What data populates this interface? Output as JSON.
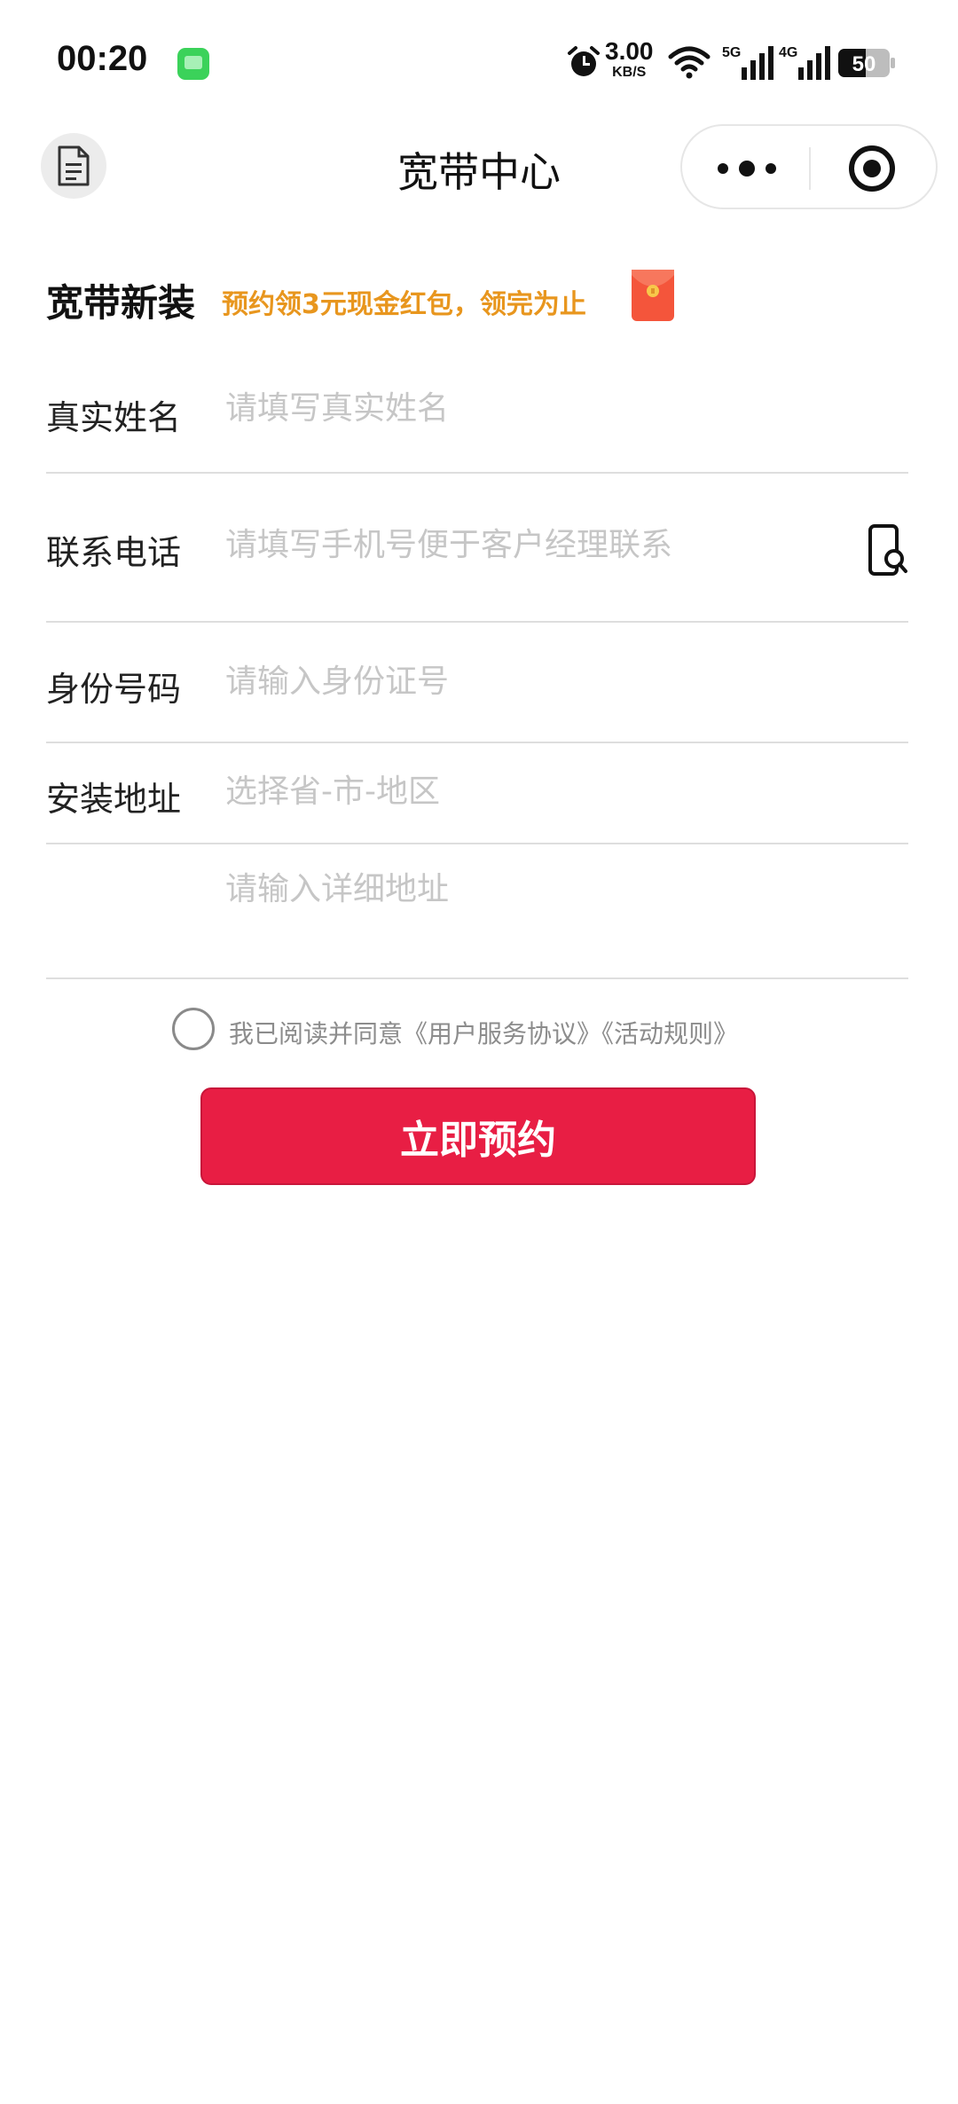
{
  "status_bar": {
    "time": "00:20",
    "net_speed_value": "3.00",
    "net_speed_unit": "KB/S",
    "net_5g": "5G",
    "net_4g": "4G",
    "battery": "50"
  },
  "nav": {
    "title": "宽带中心"
  },
  "promo": {
    "title": "宽带新装",
    "text": "预约领3元现金红包，领完为止"
  },
  "form": {
    "name": {
      "label": "真实姓名",
      "placeholder": "请填写真实姓名",
      "value": ""
    },
    "phone": {
      "label": "联系电话",
      "placeholder": "请填写手机号便于客户经理联系",
      "value": ""
    },
    "id": {
      "label": "身份号码",
      "placeholder": "请输入身份证号",
      "value": ""
    },
    "region": {
      "label": "安装地址",
      "placeholder": "选择省-市-地区",
      "value": ""
    },
    "address": {
      "placeholder": "请输入详细地址",
      "value": ""
    }
  },
  "agreement": {
    "prefix": "我已阅读并同意",
    "service_link": "《用户服务协议》",
    "rules_link": "《活动规则》"
  },
  "submit": {
    "label": "立即预约"
  },
  "colors": {
    "accent": "#e81e44",
    "promo": "#e8961e",
    "placeholder": "#c6c6c6"
  }
}
